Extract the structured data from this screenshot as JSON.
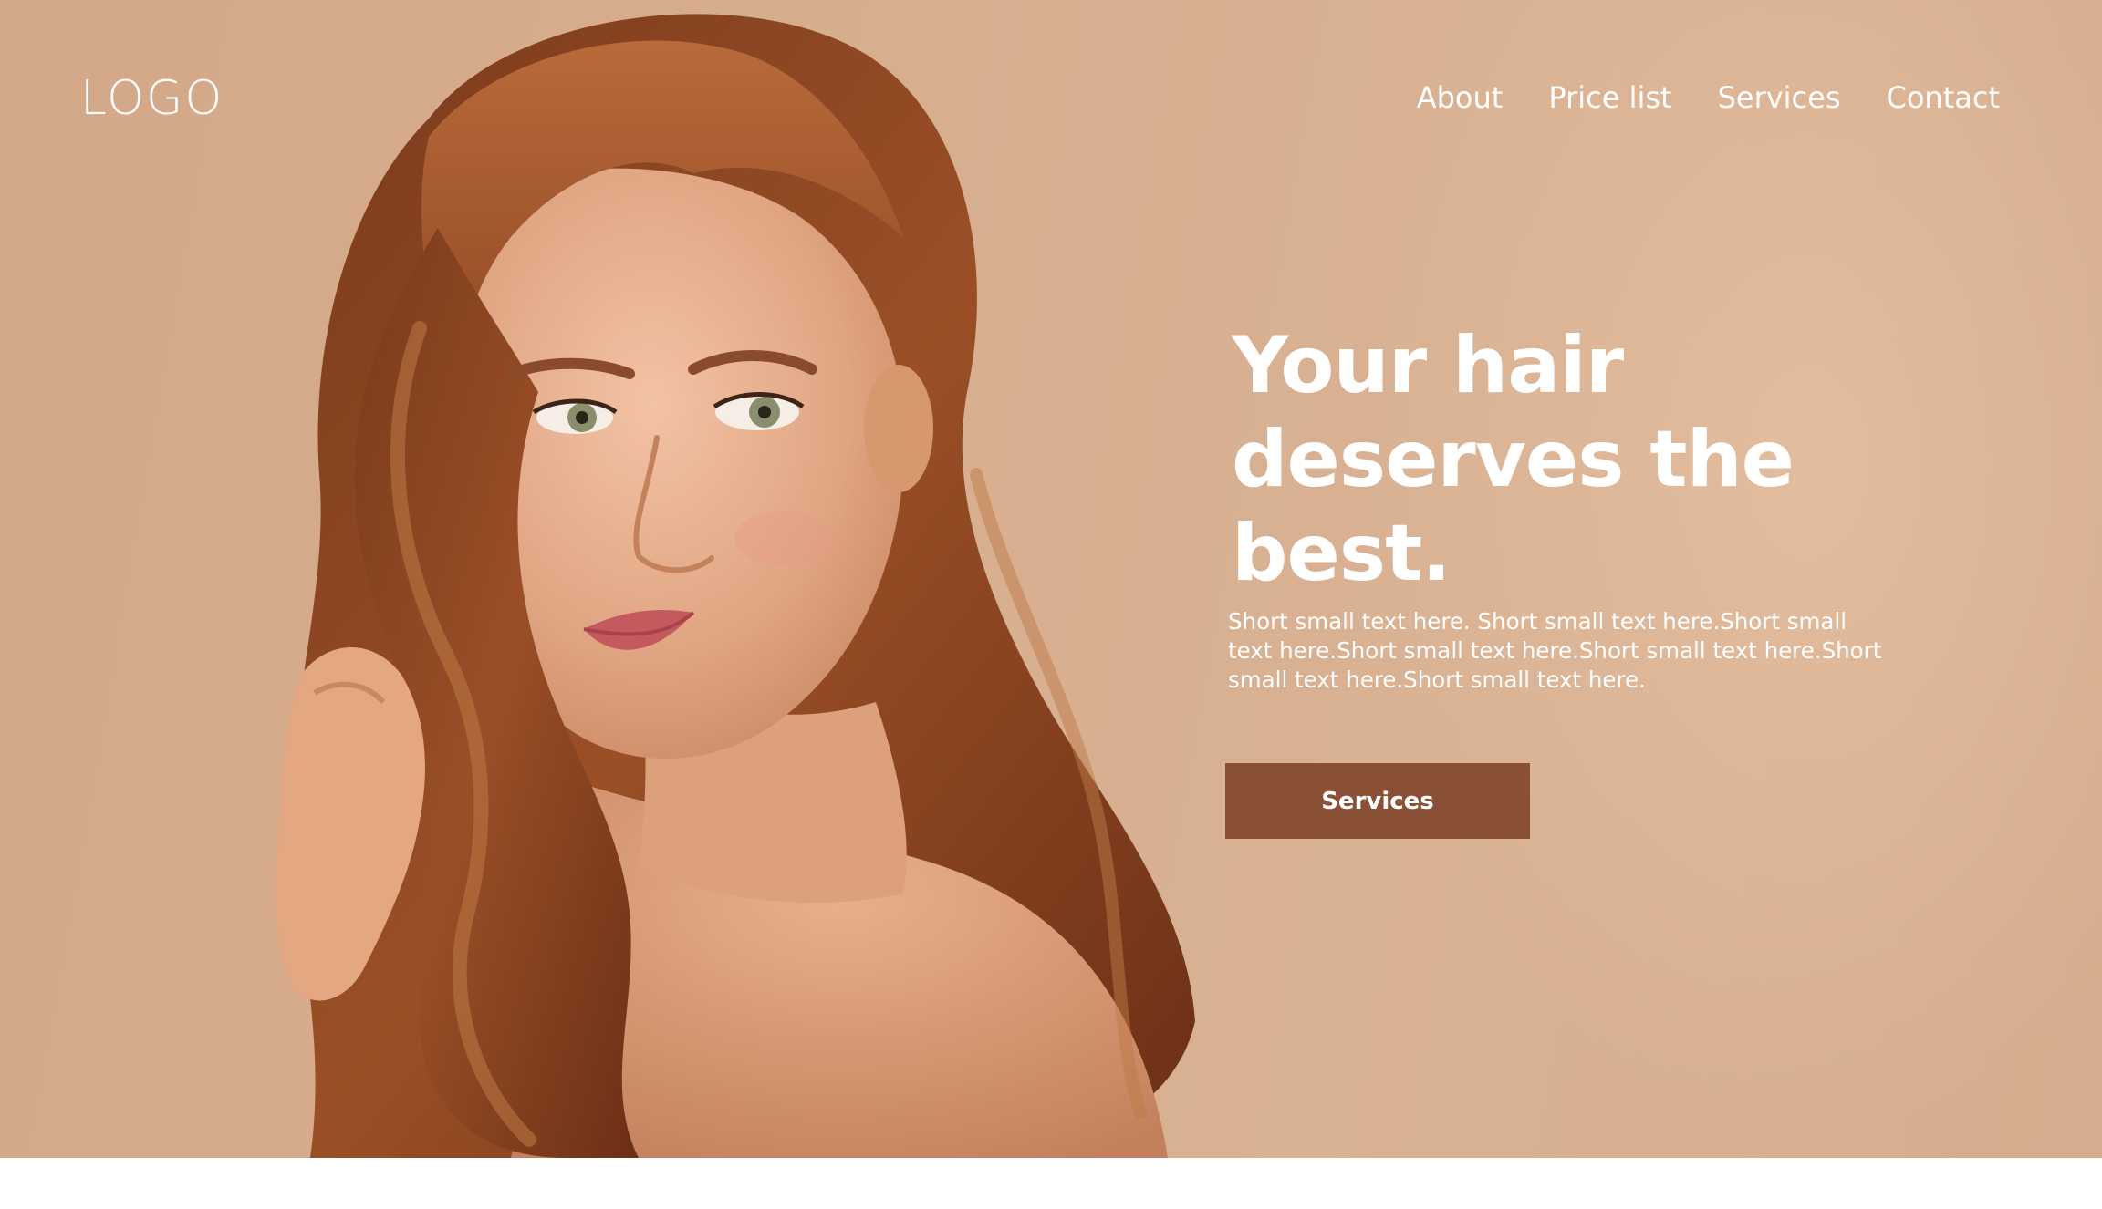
{
  "header": {
    "logo": "LOGO",
    "nav": [
      {
        "label": "About"
      },
      {
        "label": "Price list"
      },
      {
        "label": "Services"
      },
      {
        "label": "Contact"
      }
    ]
  },
  "hero": {
    "headline": "Your hair deserves the best.",
    "subtext": "Short small text here. Short small text here.Short small text here.Short small text here.Short small text here.Short small text here.Short small text here.",
    "cta_label": "Services"
  },
  "colors": {
    "background": "#d6ad8e",
    "cta": "#8a5036",
    "text": "#ffffff"
  }
}
